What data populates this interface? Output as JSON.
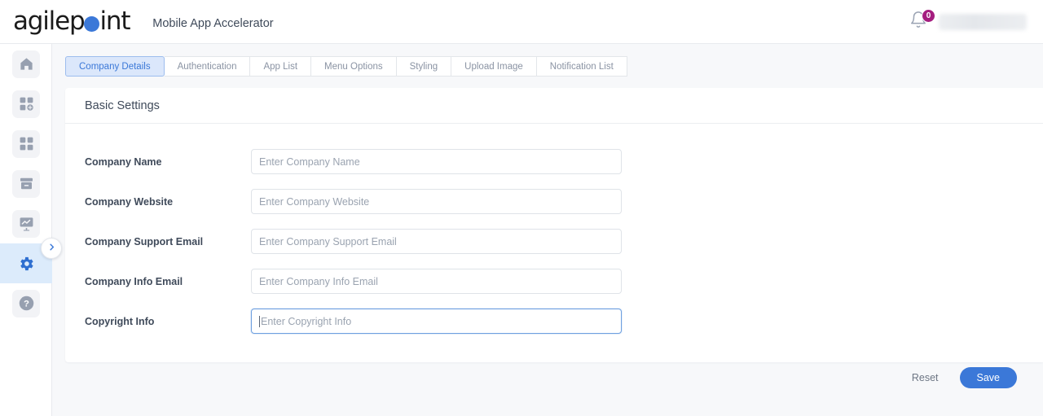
{
  "header": {
    "logo_text_pre": "agilep",
    "logo_text_post": "int",
    "logo_icon": "blue-dot",
    "app_title": "Mobile App Accelerator",
    "notification_icon": "bell-icon",
    "notification_count": "0",
    "badge_color": "#a41d7f",
    "user_name": ""
  },
  "sidebar": {
    "items": [
      {
        "icon": "home-icon",
        "label": "Home",
        "active": false
      },
      {
        "icon": "add-app-icon",
        "label": "Add App",
        "active": false
      },
      {
        "icon": "apps-grid-icon",
        "label": "Apps",
        "active": false
      },
      {
        "icon": "archive-icon",
        "label": "Archive",
        "active": false
      },
      {
        "icon": "analytics-icon",
        "label": "Analytics",
        "active": false
      },
      {
        "icon": "gear-icon",
        "label": "Settings",
        "active": true
      },
      {
        "icon": "help-icon",
        "label": "Help",
        "active": false
      }
    ],
    "expander_icon": "chevron-right-icon"
  },
  "tabs": [
    {
      "label": "Company Details",
      "active": true
    },
    {
      "label": "Authentication",
      "active": false
    },
    {
      "label": "App List",
      "active": false
    },
    {
      "label": "Menu Options",
      "active": false
    },
    {
      "label": "Styling",
      "active": false
    },
    {
      "label": "Upload Image",
      "active": false
    },
    {
      "label": "Notification List",
      "active": false
    }
  ],
  "panel": {
    "title": "Basic Settings",
    "fields": [
      {
        "label": "Company Name",
        "value": "",
        "placeholder": "Enter Company Name",
        "focused": false
      },
      {
        "label": "Company Website",
        "value": "",
        "placeholder": "Enter Company Website",
        "focused": false
      },
      {
        "label": "Company Support Email",
        "value": "",
        "placeholder": "Enter Company Support Email",
        "focused": false
      },
      {
        "label": "Company Info Email",
        "value": "",
        "placeholder": "Enter Company Info Email",
        "focused": false
      },
      {
        "label": "Copyright Info",
        "value": "",
        "placeholder": "Enter Copyright Info",
        "focused": true
      }
    ]
  },
  "footer": {
    "reset_label": "Reset",
    "save_label": "Save",
    "save_color": "#3b78d8"
  }
}
